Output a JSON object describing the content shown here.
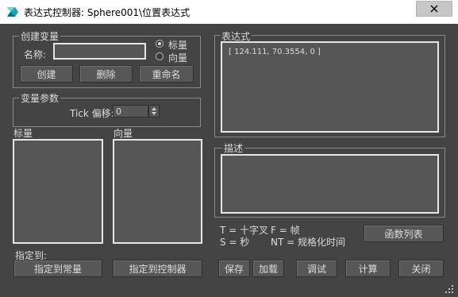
{
  "window": {
    "title": "表达式控制器: Sphere001\\位置表达式"
  },
  "create_variable": {
    "group_label": "创建变量",
    "name_label": "名称:",
    "name_value": "",
    "radio_scalar": "标量",
    "radio_vector": "向量",
    "selected": "标量",
    "create_button": "创建",
    "delete_button": "删除",
    "rename_button": "重命名"
  },
  "variable_params": {
    "group_label": "变量参数",
    "tick_offset_label": "Tick 偏移:",
    "tick_offset_value": "0"
  },
  "lists": {
    "scalar_label": "标量",
    "vector_label": "向量"
  },
  "assign": {
    "label": "指定到:",
    "to_constant_button": "指定到常量",
    "to_controller_button": "指定到控制器"
  },
  "expression": {
    "group_label": "表达式",
    "text": "[ 124.111, 70.3554, 0 ]"
  },
  "description": {
    "group_label": "描述",
    "text": ""
  },
  "legend": {
    "line1_left": "T = 十字叉",
    "line1_right": "F = 帧",
    "line2_left": "S = 秒",
    "line2_right": "NT = 规格化时间"
  },
  "buttons": {
    "function_list": "函数列表",
    "save": "保存",
    "load": "加载",
    "debug": "调试",
    "evaluate": "计算",
    "close": "关闭"
  },
  "colors": {
    "background": "#444444",
    "panel": "#565656",
    "panel_border": "#e6e6e6",
    "text": "#dcdcdc",
    "titlebar": "#ffffff",
    "icon_accent": "#1aa3b5"
  },
  "icons": {
    "app": "3dsmax-icon",
    "close": "close-icon",
    "resize": "resize-grip-icon"
  }
}
